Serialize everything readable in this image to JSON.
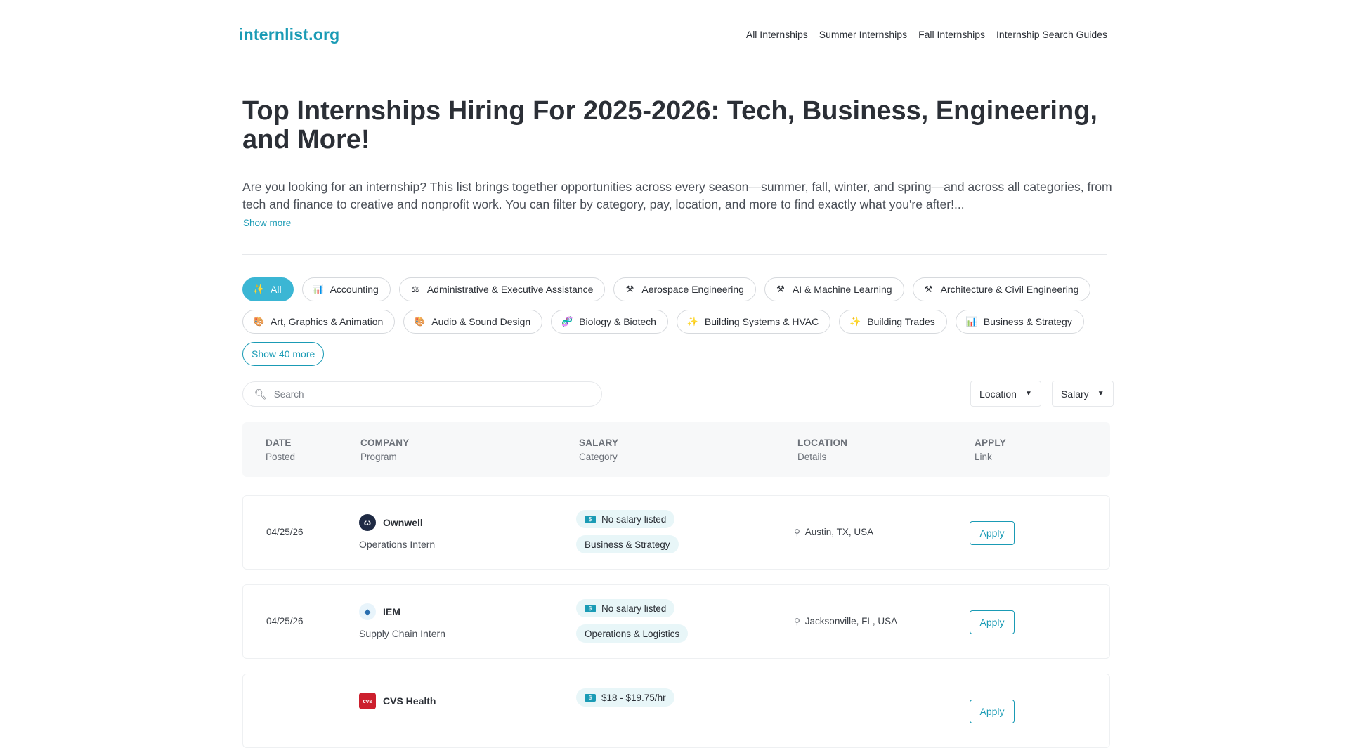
{
  "site": {
    "logo": "internlist.org"
  },
  "nav": [
    "All Internships",
    "Summer Internships",
    "Fall Internships",
    "Internship Search Guides"
  ],
  "hero": {
    "title": "Top Internships Hiring For 2025-2026: Tech, Business, Engineering, and More!",
    "description": "Are you looking for an internship? This list brings together opportunities across every season—summer, fall, winter, and spring—and across all categories, from tech and finance to creative and nonprofit work. You can filter by category, pay, location, and more to find exactly what you're after!...",
    "show_more": "Show more"
  },
  "categories": {
    "row1": [
      {
        "label": "All",
        "icon": "✨",
        "active": true
      },
      {
        "label": "Accounting",
        "icon": "📊"
      },
      {
        "label": "Administrative & Executive Assistance",
        "icon": "⚖"
      },
      {
        "label": "Aerospace Engineering",
        "icon": "⚒"
      },
      {
        "label": "AI & Machine Learning",
        "icon": "⚒"
      },
      {
        "label": "Architecture & Civil Engineering",
        "icon": "⚒"
      }
    ],
    "row2": [
      {
        "label": "Art, Graphics & Animation",
        "icon": "🎨"
      },
      {
        "label": "Audio & Sound Design",
        "icon": "🎨"
      },
      {
        "label": "Biology & Biotech",
        "icon": "🧬"
      },
      {
        "label": "Building Systems & HVAC",
        "icon": "✨"
      },
      {
        "label": "Building Trades",
        "icon": "✨"
      },
      {
        "label": "Business & Strategy",
        "icon": "📊"
      }
    ],
    "show_more": "Show 40 more"
  },
  "search": {
    "placeholder": "Search"
  },
  "filters": {
    "location": "Location",
    "salary": "Salary"
  },
  "table": {
    "headers": [
      {
        "top": "DATE",
        "sub": "Posted"
      },
      {
        "top": "COMPANY",
        "sub": "Program"
      },
      {
        "top": "SALARY",
        "sub": "Category"
      },
      {
        "top": "LOCATION",
        "sub": "Details"
      },
      {
        "top": "APPLY",
        "sub": "Link"
      }
    ],
    "rows": [
      {
        "date": "04/25/26",
        "company": "Ownwell",
        "logo_icon": "ownwell-logo",
        "program": "Operations Intern",
        "salary": "No salary listed",
        "category": "Business & Strategy",
        "location": "Austin, TX, USA",
        "apply": "Apply"
      },
      {
        "date": "04/25/26",
        "company": "IEM",
        "logo_icon": "iem-logo",
        "program": "Supply Chain Intern",
        "salary": "No salary listed",
        "category": "Operations & Logistics",
        "location": "Jacksonville, FL, USA",
        "apply": "Apply"
      },
      {
        "date": "",
        "company": "CVS Health",
        "logo_icon": "cvs-logo",
        "program": "",
        "salary": "$18 - $19.75/hr",
        "category": "",
        "location": "",
        "apply": "Apply"
      }
    ]
  },
  "colors": {
    "accent": "#1a9bb5",
    "active_chip": "#3bb6d4"
  }
}
